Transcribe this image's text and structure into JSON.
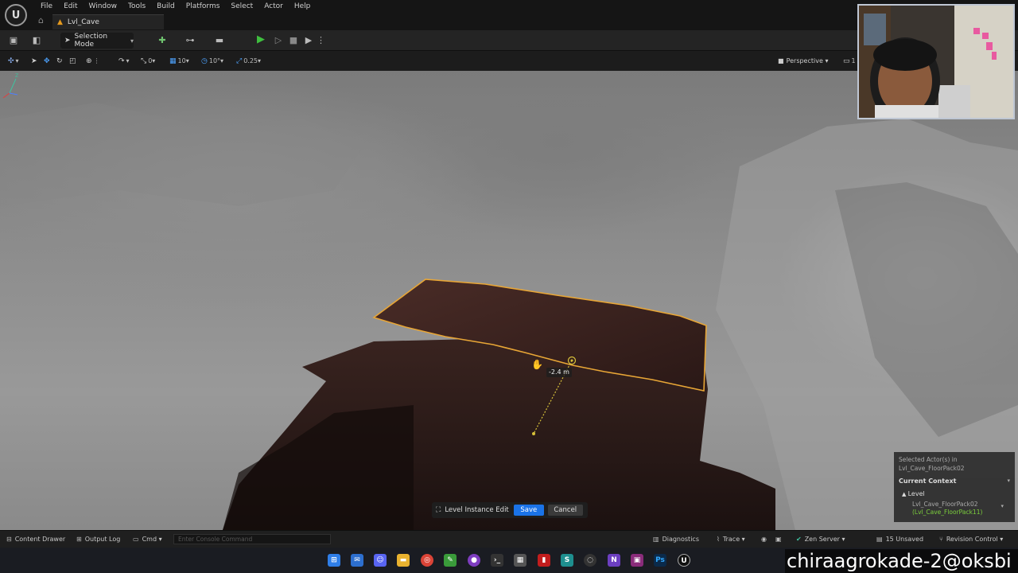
{
  "menu": {
    "items": [
      "File",
      "Edit",
      "Window",
      "Tools",
      "Build",
      "Platforms",
      "Select",
      "Actor",
      "Help"
    ]
  },
  "tab": {
    "level_name": "Lvl_Cave"
  },
  "toolbar": {
    "selection_mode_label": "Selection Mode"
  },
  "viewport_toolbar": {
    "translate_snap": "0",
    "grid_size": "10",
    "rotation_snap": "10°",
    "scale_snap": "0.25",
    "view_mode_label": "Perspective",
    "extra_label": "1"
  },
  "viewport": {
    "measurement": "-2.4 m",
    "edit_bar": {
      "label": "Level Instance Edit",
      "save_label": "Save",
      "cancel_label": "Cancel"
    },
    "context_panel": {
      "selected_line1": "Selected Actor(s) in",
      "selected_line2": "Lvl_Cave_FloorPack02",
      "title": "Current Context",
      "level_label": "Level",
      "level_item": "Lvl_Cave_FloorPack02",
      "level_item_sub": "(Lvl_Cave_FloorPack11)"
    },
    "colors": {
      "selection_outline": "#e8a636",
      "gizmo": "#d8c23a"
    }
  },
  "statusbar": {
    "content_drawer": "Content Drawer",
    "output_log": "Output Log",
    "cmd_label": "Cmd",
    "console_placeholder": "Enter Console Command",
    "diagnostics": "Diagnostics",
    "trace": "Trace",
    "zen_server": "Zen Server",
    "unsaved": "15 Unsaved",
    "revision_control": "Revision Control"
  },
  "watermark": {
    "text": "chiraagrokade-2@oksbi"
  }
}
